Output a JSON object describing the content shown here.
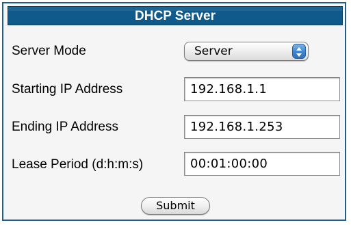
{
  "form": {
    "title": "DHCP Server",
    "server_mode": {
      "label": "Server Mode",
      "selected": "Server",
      "icon": "up-down-arrows-icon"
    },
    "starting_ip": {
      "label": "Starting IP Address",
      "value": "192.168.1.1"
    },
    "ending_ip": {
      "label": "Ending IP Address",
      "value": "192.168.1.253"
    },
    "lease_period": {
      "label": "Lease Period (d:h:m:s)",
      "value": "00:01:00:00"
    },
    "submit_label": "Submit"
  },
  "colors": {
    "header_bg": "#0f5a8a",
    "header_text": "#ffffff",
    "border": "#1f5c87",
    "select_arrow_blue": "#3c86d3"
  }
}
